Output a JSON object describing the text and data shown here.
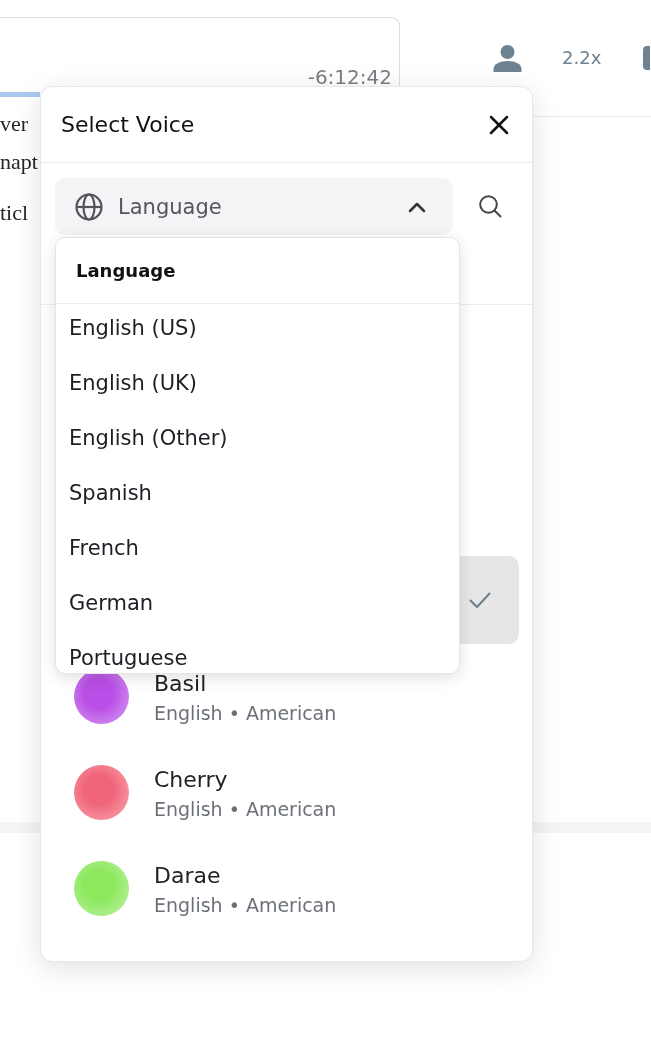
{
  "player": {
    "time_remaining": "-6:12:42",
    "progress": {
      "level": 0.1
    }
  },
  "toolbar": {
    "speed": "2.2x"
  },
  "document": {
    "paragraphs": [
      {
        "lines": [
          "ver",
          "napt"
        ]
      },
      {
        "lines": [
          "ticl"
        ]
      }
    ]
  },
  "dialog": {
    "title": "Select Voice",
    "language_filter": {
      "label": "Language",
      "expanded": true
    },
    "language_menu": {
      "title": "Language",
      "options": [
        {
          "label": "English (US)",
          "selected": false
        },
        {
          "label": "English (UK)",
          "selected": false
        },
        {
          "label": "English (Other)",
          "selected": false
        },
        {
          "label": "Spanish",
          "selected": false
        },
        {
          "label": "French",
          "selected": false
        },
        {
          "label": "German",
          "selected": false
        },
        {
          "label": "Portuguese",
          "selected": false
        }
      ]
    },
    "voices": [
      {
        "selected": true
      },
      {
        "name": "Basil",
        "subtitle": "English • American",
        "color": "#b94fe6",
        "selected": false
      },
      {
        "name": "Cherry",
        "subtitle": "English • American",
        "color": "#f0657a",
        "selected": false
      },
      {
        "name": "Darae",
        "subtitle": "English • American",
        "color": "#8de85e",
        "selected": false
      }
    ]
  }
}
